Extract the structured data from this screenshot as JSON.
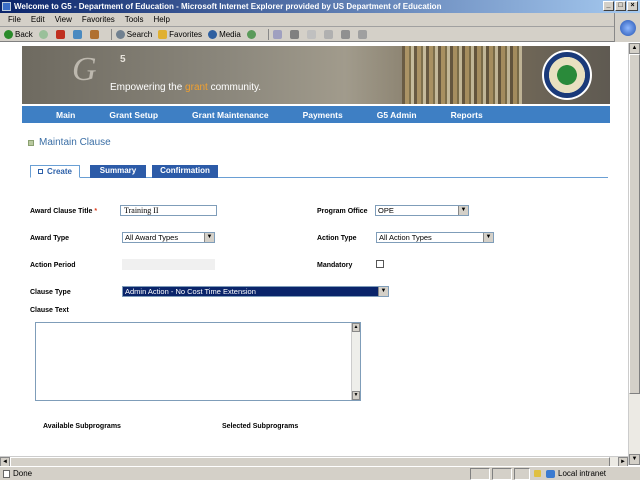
{
  "window": {
    "title": "Welcome to G5 - Department of Education - Microsoft Internet Explorer provided by US Department of Education",
    "controls": [
      "_",
      "□",
      "×"
    ]
  },
  "menubar": [
    "File",
    "Edit",
    "View",
    "Favorites",
    "Tools",
    "Help"
  ],
  "toolbar": {
    "back": "Back",
    "search": "Search",
    "favorites": "Favorites",
    "media": "Media"
  },
  "banner": {
    "logo_g": "G",
    "logo_sup": "5",
    "tagline_pre": "Empowering the ",
    "tagline_hl": "grant",
    "tagline_post": " community."
  },
  "nav": [
    "Main",
    "Grant Setup",
    "Grant Maintenance",
    "Payments",
    "G5 Admin",
    "Reports"
  ],
  "page": {
    "title": "Maintain Clause"
  },
  "tabs": [
    {
      "label": "Create",
      "active": true
    },
    {
      "label": "Summary",
      "active": false
    },
    {
      "label": "Confirmation",
      "active": false
    }
  ],
  "form": {
    "award_clause_title_label": "Award Clause Title",
    "required_mark": "*",
    "award_clause_title_value": "Training II",
    "program_office_label": "Program Office",
    "program_office_value": "OPE",
    "award_type_label": "Award Type",
    "award_type_value": "All Award Types",
    "action_type_label": "Action Type",
    "action_type_value": "All Action Types",
    "action_period_label": "Action Period",
    "mandatory_label": "Mandatory",
    "clause_type_label": "Clause Type",
    "clause_type_value": "Admin Action - No Cost Time Extension",
    "clause_text_label": "Clause Text",
    "available_subprograms_label": "Available Subprograms",
    "selected_subprograms_label": "Selected Subprograms"
  },
  "status": {
    "text": "Done",
    "zone": "Local intranet"
  },
  "colors": {
    "nav_bar": "#3e7fc4",
    "tab_inactive": "#2c5ba8",
    "page_title": "#3a6ea5",
    "title_bar": "#0a246a"
  }
}
